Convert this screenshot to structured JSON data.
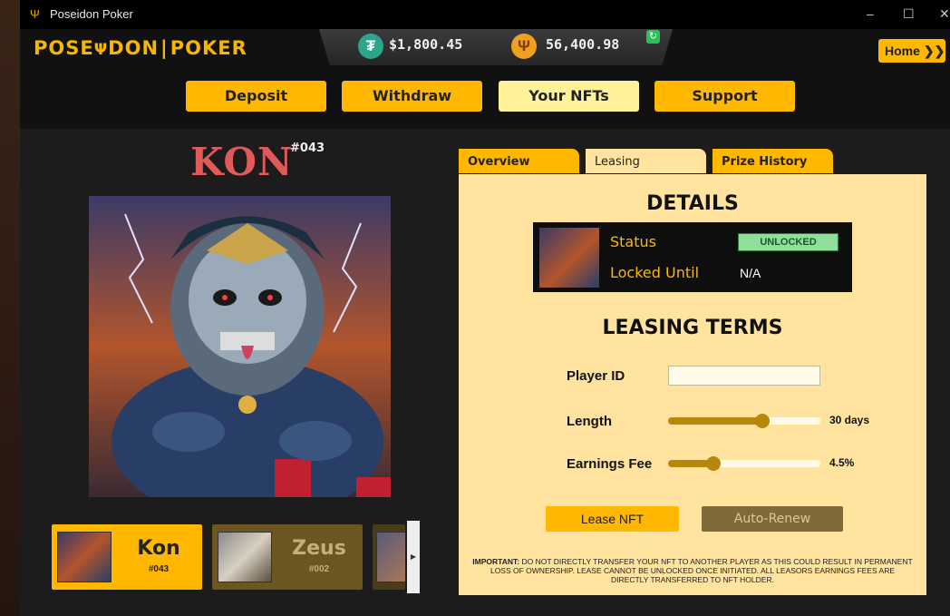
{
  "app": {
    "title": "Poseidon Poker",
    "logo_left": "POSE",
    "logo_mid": "Ψ",
    "logo_right": "DON",
    "logo_right2": "POKER"
  },
  "balances": {
    "usdt": "$1,800.45",
    "poseidon": "56,400.98"
  },
  "header": {
    "home_label": "Home"
  },
  "nav": [
    {
      "label": "Deposit"
    },
    {
      "label": "Withdraw"
    },
    {
      "label": "Your NFTs",
      "active": true
    },
    {
      "label": "Support"
    }
  ],
  "nft": {
    "name": "KON",
    "number": "#043"
  },
  "carousel": [
    {
      "name": "Kon",
      "number": "#043",
      "selected": true
    },
    {
      "name": "Zeus",
      "number": "#002",
      "selected": false
    }
  ],
  "tabs": [
    {
      "label": "Overview"
    },
    {
      "label": "Leasing",
      "active": true
    },
    {
      "label": "Prize History"
    }
  ],
  "details": {
    "title": "DETAILS",
    "status_label": "Status",
    "status_value": "UNLOCKED",
    "locked_label": "Locked Until",
    "locked_value": "N/A"
  },
  "leasing": {
    "title": "LEASING TERMS",
    "player_id_label": "Player ID",
    "player_id_value": "",
    "length_label": "Length",
    "length_value": "30 days",
    "length_fraction": 0.62,
    "fee_label": "Earnings Fee",
    "fee_value": "4.5%",
    "fee_fraction": 0.3,
    "lease_button": "Lease NFT",
    "renew_button": "Auto-Renew"
  },
  "notice": {
    "bold": "IMPORTANT:",
    "text": "DO NOT DIRECTLY TRANSFER YOUR NFT TO ANOTHER PLAYER AS THIS COULD RESULT IN PERMANENT LOSS OF OWNERSHIP. LEASE CANNOT BE UNLOCKED ONCE INITIATED. ALL LEASORS EARNINGS FEES ARE DIRECTLY TRANSFERRED TO NFT HOLDER."
  },
  "colors": {
    "accent": "#ffb700",
    "panel": "#ffe39e",
    "status_green": "#8fdf9a"
  }
}
